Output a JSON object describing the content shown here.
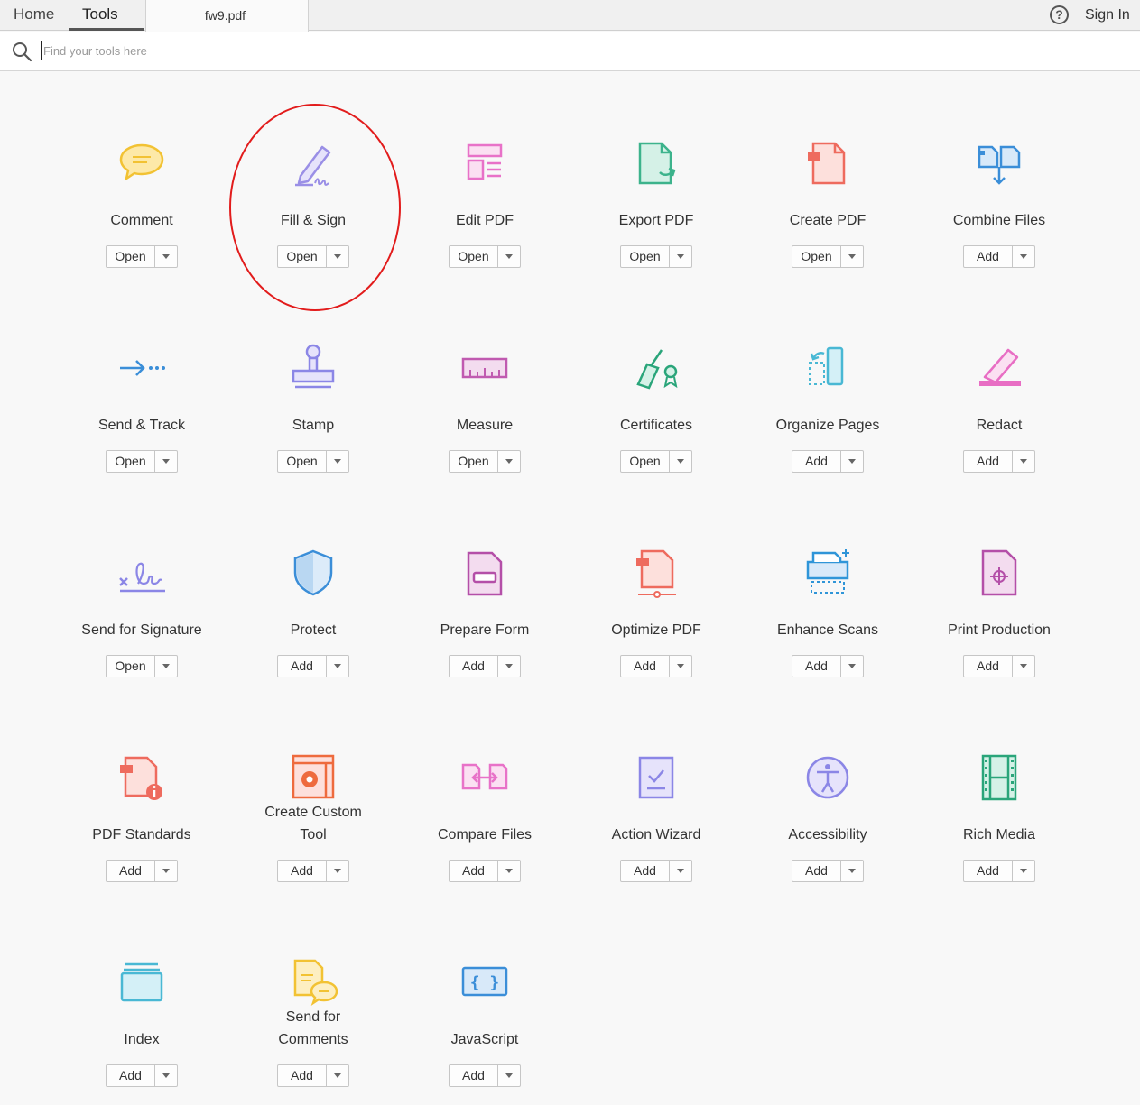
{
  "nav": {
    "home": "Home",
    "tools": "Tools",
    "document_tab": "fw9.pdf",
    "sign_in": "Sign In",
    "help": "?"
  },
  "search": {
    "placeholder": "Find your tools here",
    "value": ""
  },
  "tools": [
    {
      "name": "Comment",
      "action": "Open",
      "icon": "comment-icon",
      "color": "#f2c233"
    },
    {
      "name": "Fill & Sign",
      "action": "Open",
      "icon": "fill-sign-icon",
      "color": "#9a8fe6"
    },
    {
      "name": "Edit PDF",
      "action": "Open",
      "icon": "edit-pdf-icon",
      "color": "#e872c8"
    },
    {
      "name": "Export PDF",
      "action": "Open",
      "icon": "export-pdf-icon",
      "color": "#3db38c"
    },
    {
      "name": "Create PDF",
      "action": "Open",
      "icon": "create-pdf-icon",
      "color": "#ee6b5e"
    },
    {
      "name": "Combine Files",
      "action": "Add",
      "icon": "combine-files-icon",
      "color": "#3b8ed8"
    },
    {
      "name": "Send & Track",
      "action": "Open",
      "icon": "send-track-icon",
      "color": "#3b8ed8"
    },
    {
      "name": "Stamp",
      "action": "Open",
      "icon": "stamp-icon",
      "color": "#8b86e6"
    },
    {
      "name": "Measure",
      "action": "Open",
      "icon": "measure-icon",
      "color": "#c05ab0"
    },
    {
      "name": "Certificates",
      "action": "Open",
      "icon": "certificates-icon",
      "color": "#2aa57a"
    },
    {
      "name": "Organize Pages",
      "action": "Add",
      "icon": "organize-pages-icon",
      "color": "#49b8d4"
    },
    {
      "name": "Redact",
      "action": "Add",
      "icon": "redact-icon",
      "color": "#e86ec4"
    },
    {
      "name": "Send for Signature",
      "action": "Open",
      "icon": "send-signature-icon",
      "color": "#8b86e6"
    },
    {
      "name": "Protect",
      "action": "Add",
      "icon": "protect-icon",
      "color": "#3b8ed8"
    },
    {
      "name": "Prepare Form",
      "action": "Add",
      "icon": "prepare-form-icon",
      "color": "#b44fa8"
    },
    {
      "name": "Optimize PDF",
      "action": "Add",
      "icon": "optimize-pdf-icon",
      "color": "#ee6b5e"
    },
    {
      "name": "Enhance Scans",
      "action": "Add",
      "icon": "enhance-scans-icon",
      "color": "#2f95d8"
    },
    {
      "name": "Print Production",
      "action": "Add",
      "icon": "print-production-icon",
      "color": "#b44fa8"
    },
    {
      "name": "PDF Standards",
      "action": "Add",
      "icon": "pdf-standards-icon",
      "color": "#ee6b5e"
    },
    {
      "name": "Create Custom Tool",
      "action": "Add",
      "icon": "create-custom-tool-icon",
      "color": "#ee6b3e"
    },
    {
      "name": "Compare Files",
      "action": "Add",
      "icon": "compare-files-icon",
      "color": "#e872c8"
    },
    {
      "name": "Action Wizard",
      "action": "Add",
      "icon": "action-wizard-icon",
      "color": "#8b86e6"
    },
    {
      "name": "Accessibility",
      "action": "Add",
      "icon": "accessibility-icon",
      "color": "#8b86e6"
    },
    {
      "name": "Rich Media",
      "action": "Add",
      "icon": "rich-media-icon",
      "color": "#2aa57a"
    },
    {
      "name": "Index",
      "action": "Add",
      "icon": "index-icon",
      "color": "#49b8d4"
    },
    {
      "name": "Send for Comments",
      "action": "Add",
      "icon": "send-comments-icon",
      "color": "#f2c233"
    },
    {
      "name": "JavaScript",
      "action": "Add",
      "icon": "javascript-icon",
      "color": "#3b8ed8"
    }
  ],
  "highlight": {
    "color": "#e21c1c"
  }
}
